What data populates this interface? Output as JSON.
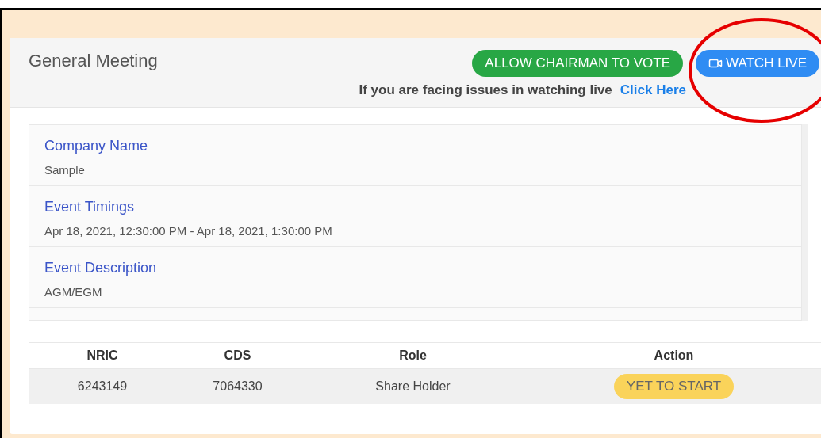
{
  "card": {
    "title": "General Meeting",
    "buttons": [
      {
        "label": "ALLOW CHAIRMAN TO VOTE",
        "kind": "vote"
      },
      {
        "label": "WATCH LIVE",
        "kind": "live"
      }
    ],
    "notice": {
      "text": "If you are facing issues in watching live",
      "link": "Click Here"
    }
  },
  "details": [
    {
      "label": "Company Name",
      "value": "Sample"
    },
    {
      "label": "Event Timings",
      "value": "Apr 18, 2021, 12:30:00 PM - Apr 18, 2021, 1:30:00 PM"
    },
    {
      "label": "Event Description",
      "value": "AGM/EGM"
    }
  ],
  "table": {
    "columns": [
      "NRIC",
      "CDS",
      "Role",
      "Action"
    ],
    "rows": [
      {
        "cells": [
          "6243149",
          "7064330",
          "Share Holder"
        ],
        "status": "YET TO START"
      }
    ]
  }
}
